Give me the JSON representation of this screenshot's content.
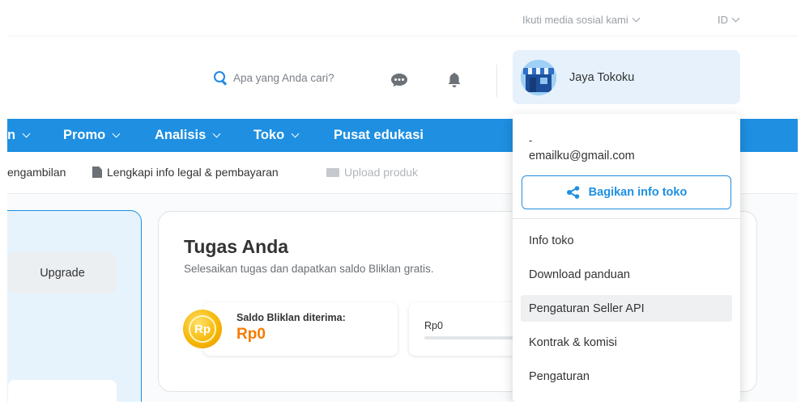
{
  "topbar": {
    "social_label": "Ikuti media sosial kami",
    "lang_label": "ID"
  },
  "header": {
    "search_placeholder": "Apa yang Anda cari?",
    "store_name": "Jaya Tokoku"
  },
  "nav": {
    "items": [
      {
        "label": "n"
      },
      {
        "label": "Promo"
      },
      {
        "label": "Analisis"
      },
      {
        "label": "Toko"
      },
      {
        "label": "Pusat edukasi"
      }
    ]
  },
  "subbar": {
    "items": [
      {
        "label": "engambilan"
      },
      {
        "label": "Lengkapi info legal & pembayaran"
      },
      {
        "label": "Upload produk"
      }
    ]
  },
  "left_panel": {
    "upgrade_label": "Upgrade"
  },
  "tasks": {
    "title": "Tugas Anda",
    "subtitle": "Selesaikan tugas dan dapatkan saldo Bliklan gratis.",
    "coin_label": "Rp",
    "saldo_label": "Saldo Bliklan diterima:",
    "saldo_value": "Rp0",
    "rp_value": "Rp0"
  },
  "dropdown": {
    "dash": "-",
    "email": "emailku@gmail.com",
    "share_label": "Bagikan info toko",
    "items": [
      {
        "label": "Info toko"
      },
      {
        "label": "Download panduan"
      },
      {
        "label": "Pengaturan Seller API"
      },
      {
        "label": "Kontrak & komisi"
      },
      {
        "label": "Pengaturan"
      }
    ],
    "highlighted_index": 2
  },
  "colors": {
    "primary": "#1e8fe1",
    "accent_orange": "#f57c00",
    "coin_gold": "#f5b400"
  }
}
